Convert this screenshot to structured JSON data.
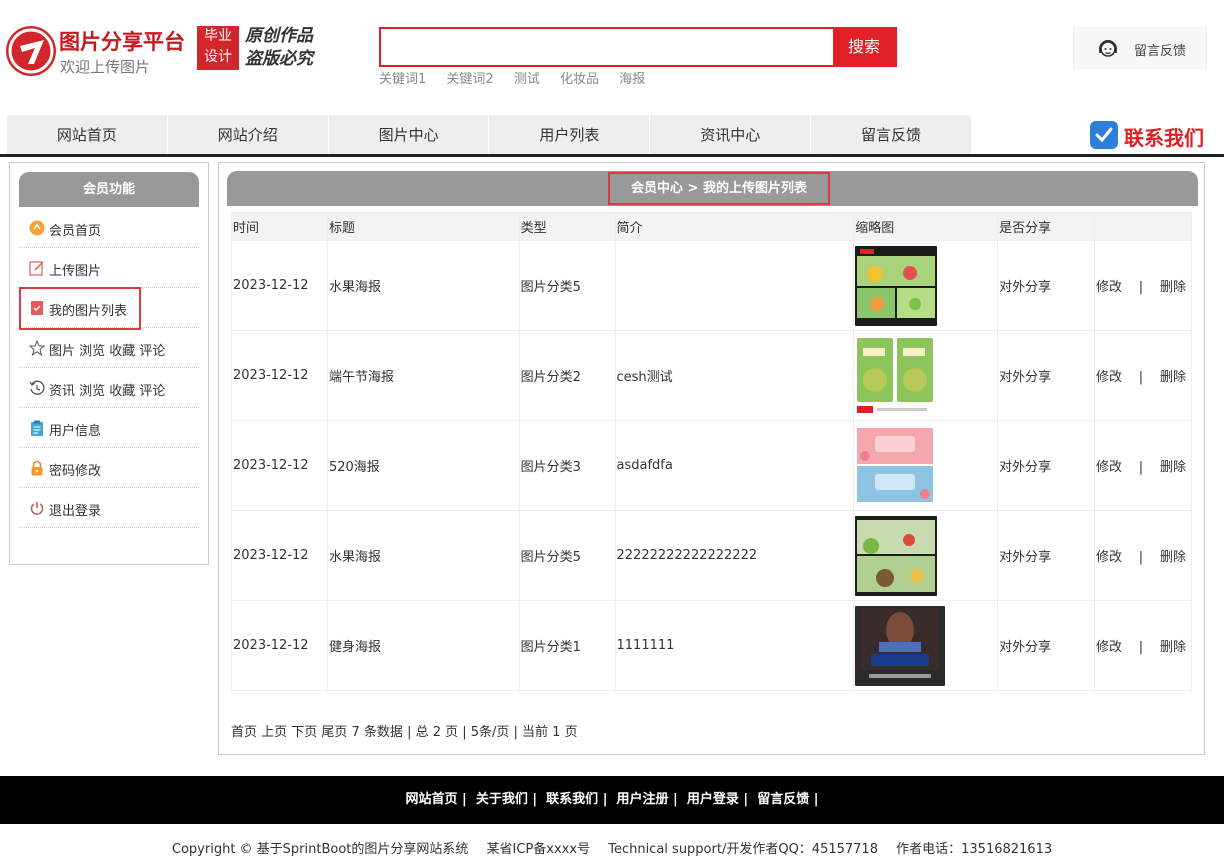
{
  "header": {
    "logo_title": "图片分享平台",
    "logo_sub": "欢迎上传图片",
    "logo_tag": [
      "毕业",
      "设计"
    ],
    "logo_slogan": [
      "原创作品",
      "盗版必究"
    ],
    "search": {
      "placeholder": "",
      "value": "",
      "button": "搜索"
    },
    "hot_words": [
      "关键词1",
      "关键词2",
      "测试",
      "化妆品",
      "海报"
    ],
    "feedback_label": "留言反馈",
    "brand_color": "#e01f26"
  },
  "nav": {
    "items": [
      "网站首页",
      "网站介绍",
      "图片中心",
      "用户列表",
      "资讯中心",
      "留言反馈"
    ],
    "contact_label": "联系我们"
  },
  "sidebar": {
    "title": "会员功能",
    "items": [
      {
        "label": "会员首页",
        "icon": "member-home-icon"
      },
      {
        "label": "上传图片",
        "icon": "upload-edit-icon"
      },
      {
        "label": "我的图片列表",
        "icon": "my-list-icon",
        "active": true
      },
      {
        "label": "图片 浏览 收藏 评论",
        "icon": "star-icon"
      },
      {
        "label": "资讯 浏览 收藏 评论",
        "icon": "history-icon"
      },
      {
        "label": "用户信息",
        "icon": "clipboard-icon"
      },
      {
        "label": "密码修改",
        "icon": "lock-icon"
      },
      {
        "label": "退出登录",
        "icon": "power-icon"
      }
    ]
  },
  "main": {
    "breadcrumb": "会员中心 > 我的上传图片列表",
    "columns": [
      "时间",
      "标题",
      "类型",
      "简介",
      "缩略图",
      "是否分享",
      ""
    ],
    "rows": [
      {
        "time": "2023-12-12",
        "title": "水果海报",
        "type": "图片分类5",
        "desc": "",
        "share": "对外分享",
        "edit": "修改",
        "sep": "|",
        "del": "删除",
        "thumb": "fruit-poster"
      },
      {
        "time": "2023-12-12",
        "title": "端午节海报",
        "type": "图片分类2",
        "desc": "cesh测试",
        "share": "对外分享",
        "edit": "修改",
        "sep": "|",
        "del": "删除",
        "thumb": "dragon-boat-poster"
      },
      {
        "time": "2023-12-12",
        "title": "520海报",
        "type": "图片分类3",
        "desc": "asdafdfa",
        "share": "对外分享",
        "edit": "修改",
        "sep": "|",
        "del": "删除",
        "thumb": "520-poster"
      },
      {
        "time": "2023-12-12",
        "title": "水果海报",
        "type": "图片分类5",
        "desc": "22222222222222222",
        "share": "对外分享",
        "edit": "修改",
        "sep": "|",
        "del": "删除",
        "thumb": "fruit-poster-2"
      },
      {
        "time": "2023-12-12",
        "title": "健身海报",
        "type": "图片分类1",
        "desc": "1111111",
        "share": "对外分享",
        "edit": "修改",
        "sep": "|",
        "del": "删除",
        "thumb": "fitness-poster"
      }
    ],
    "pager": "首页 上页 下页 尾页 7 条数据 | 总 2 页 | 5条/页 | 当前 1 页"
  },
  "footer": {
    "links": [
      "网站首页",
      "关于我们",
      "联系我们",
      "用户注册",
      "用户登录",
      "留言反馈"
    ],
    "copyright": [
      "Copyright © 基于SprintBoot的图片分享网站系统",
      "某省ICP备xxxx号",
      "Technical support/开发作者QQ：45157718",
      "作者电话：13516821613"
    ]
  }
}
